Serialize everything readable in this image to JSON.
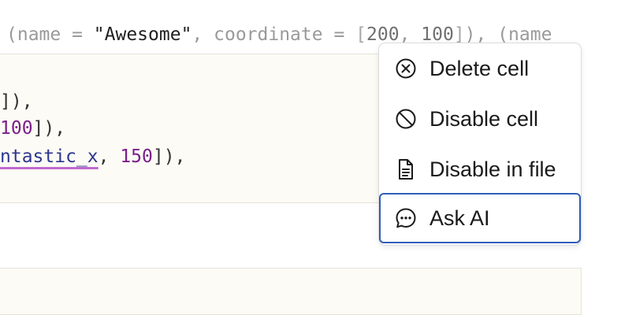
{
  "output": {
    "open": "(",
    "name_key": "name",
    "eq1": " = ",
    "name_val": "\"Awesome\"",
    "sep1": ", ",
    "coord_key": "coordinate",
    "eq2": " = ",
    "lb": "[",
    "num1": "200",
    "comma": ", ",
    "num2": "100",
    "rb": "]",
    "tail": "), (name"
  },
  "code": {
    "line1": "]),",
    "line2_num": "100",
    "line2_tail": "]),",
    "line3_ident": "ntastic_x",
    "line3_sep": ", ",
    "line3_num": "150",
    "line3_tail": "]),"
  },
  "menu": {
    "items": [
      {
        "label": "Delete cell",
        "icon": "close-circle-icon"
      },
      {
        "label": "Disable cell",
        "icon": "prohibited-icon"
      },
      {
        "label": "Disable in file",
        "icon": "file-document-icon"
      },
      {
        "label": "Ask AI",
        "icon": "chat-bubble-icon"
      }
    ],
    "selected_index": 3,
    "accent_color": "#2f5db8"
  }
}
